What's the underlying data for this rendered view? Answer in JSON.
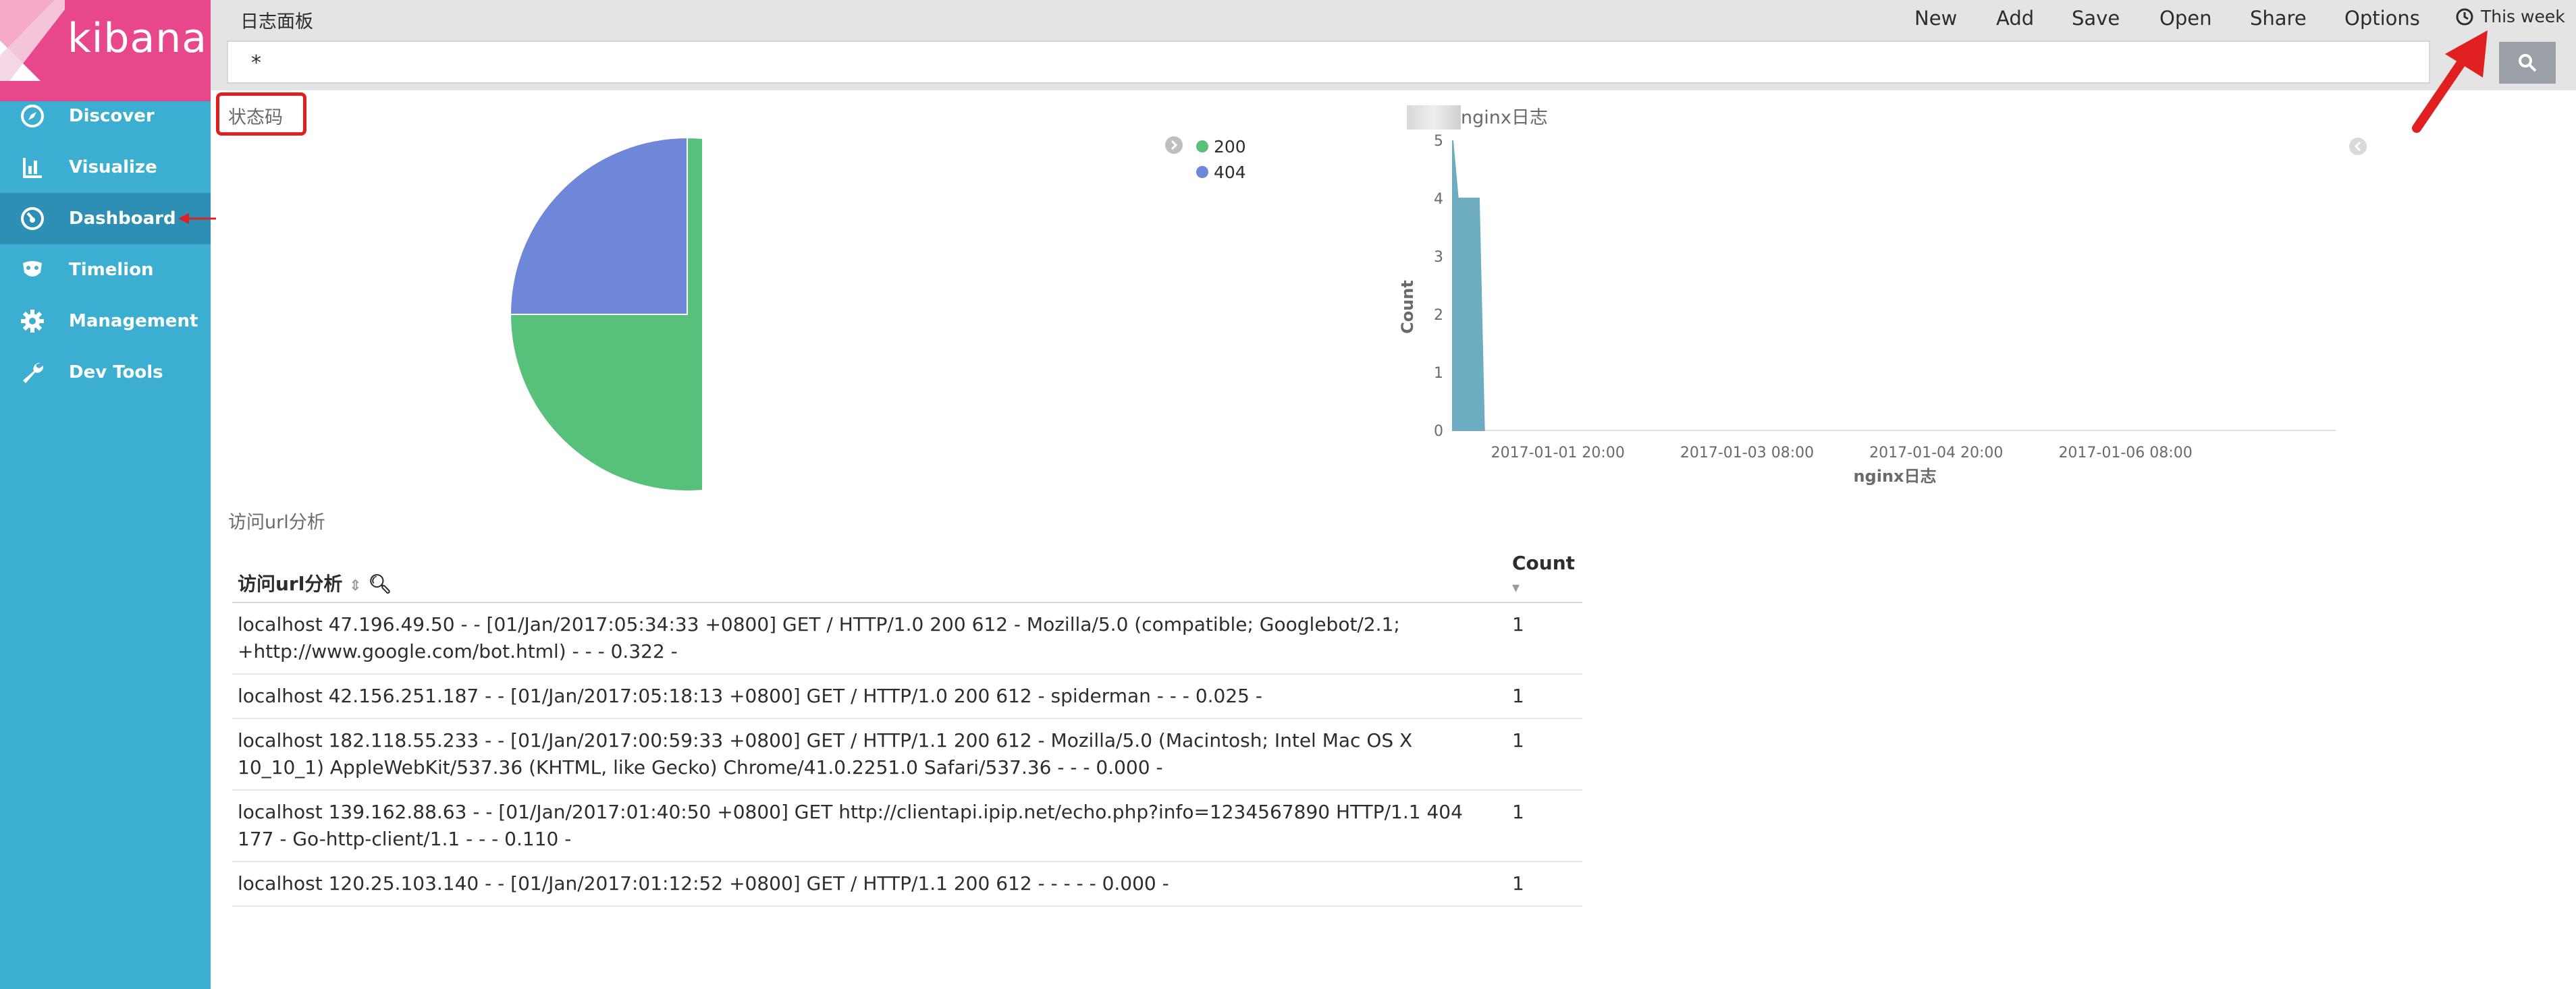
{
  "app": {
    "logo_text": "kibana",
    "brand_color": "#e8488b",
    "sidebar_color": "#3caed2"
  },
  "sidebar": {
    "items": [
      {
        "label": "Discover",
        "icon": "compass-icon"
      },
      {
        "label": "Visualize",
        "icon": "bar-chart-icon"
      },
      {
        "label": "Dashboard",
        "icon": "dashboard-gauge-icon",
        "active": true
      },
      {
        "label": "Timelion",
        "icon": "timelion-mask-icon"
      },
      {
        "label": "Management",
        "icon": "gear-icon"
      },
      {
        "label": "Dev Tools",
        "icon": "wrench-icon"
      }
    ]
  },
  "header": {
    "title": "日志面板",
    "buttons": {
      "new": "New",
      "add": "Add",
      "save": "Save",
      "open": "Open",
      "share": "Share",
      "options": "Options"
    },
    "timepicker": "This week"
  },
  "query": {
    "value": "*"
  },
  "panels": {
    "pie": {
      "title": "状态码",
      "legend": [
        {
          "label": "200",
          "color": "#57c17b"
        },
        {
          "label": "404",
          "color": "#6f87d8"
        }
      ]
    },
    "histogram": {
      "title_suffix": "nginx日志",
      "ylabel": "Count",
      "xlabel": "nginx日志",
      "color": "#6eadc1"
    },
    "table": {
      "title": "访问url分析",
      "col_message": "访问url分析",
      "col_count": "Count",
      "rows": [
        {
          "message": "localhost 47.196.49.50 - - [01/Jan/2017:05:34:33 +0800] GET / HTTP/1.0 200 612 - Mozilla/5.0 (compatible; Googlebot/2.1; +http://www.google.com/bot.html) - - - 0.322 -",
          "count": "1"
        },
        {
          "message": "localhost 42.156.251.187 - - [01/Jan/2017:05:18:13 +0800] GET / HTTP/1.0 200 612 - spiderman - - - 0.025 -",
          "count": "1"
        },
        {
          "message": "localhost 182.118.55.233 - - [01/Jan/2017:00:59:33 +0800] GET / HTTP/1.1 200 612 - Mozilla/5.0 (Macintosh; Intel Mac OS X 10_10_1) AppleWebKit/537.36 (KHTML, like Gecko) Chrome/41.0.2251.0 Safari/537.36 - - - 0.000 -",
          "count": "1"
        },
        {
          "message": "localhost 139.162.88.63 - - [01/Jan/2017:01:40:50 +0800] GET http://clientapi.ipip.net/echo.php?info=1234567890 HTTP/1.1 404 177 - Go-http-client/1.1 - - - 0.110 -",
          "count": "1"
        },
        {
          "message": "localhost 120.25.103.140 - - [01/Jan/2017:01:12:52 +0800] GET / HTTP/1.1 200 612 - - - - - 0.000 -",
          "count": "1"
        }
      ]
    }
  },
  "chart_data": [
    {
      "type": "pie",
      "title": "状态码",
      "categories": [
        "200",
        "404"
      ],
      "values": [
        75,
        25
      ],
      "colors": [
        "#57c17b",
        "#6f87d8"
      ]
    },
    {
      "type": "area",
      "title": "nginx日志",
      "xlabel": "nginx日志",
      "ylabel": "Count",
      "ylim": [
        0,
        5
      ],
      "yticks": [
        "0",
        "1",
        "2",
        "3",
        "4",
        "5"
      ],
      "xticks": [
        "2017-01-01 20:00",
        "2017-01-03 08:00",
        "2017-01-04 20:00",
        "2017-01-06 08:00"
      ],
      "x": [
        "2017-01-01 00:00",
        "2017-01-01 01:00",
        "2017-01-01 05:00",
        "2017-01-01 06:00"
      ],
      "values": [
        5,
        4,
        4,
        0
      ]
    }
  ]
}
